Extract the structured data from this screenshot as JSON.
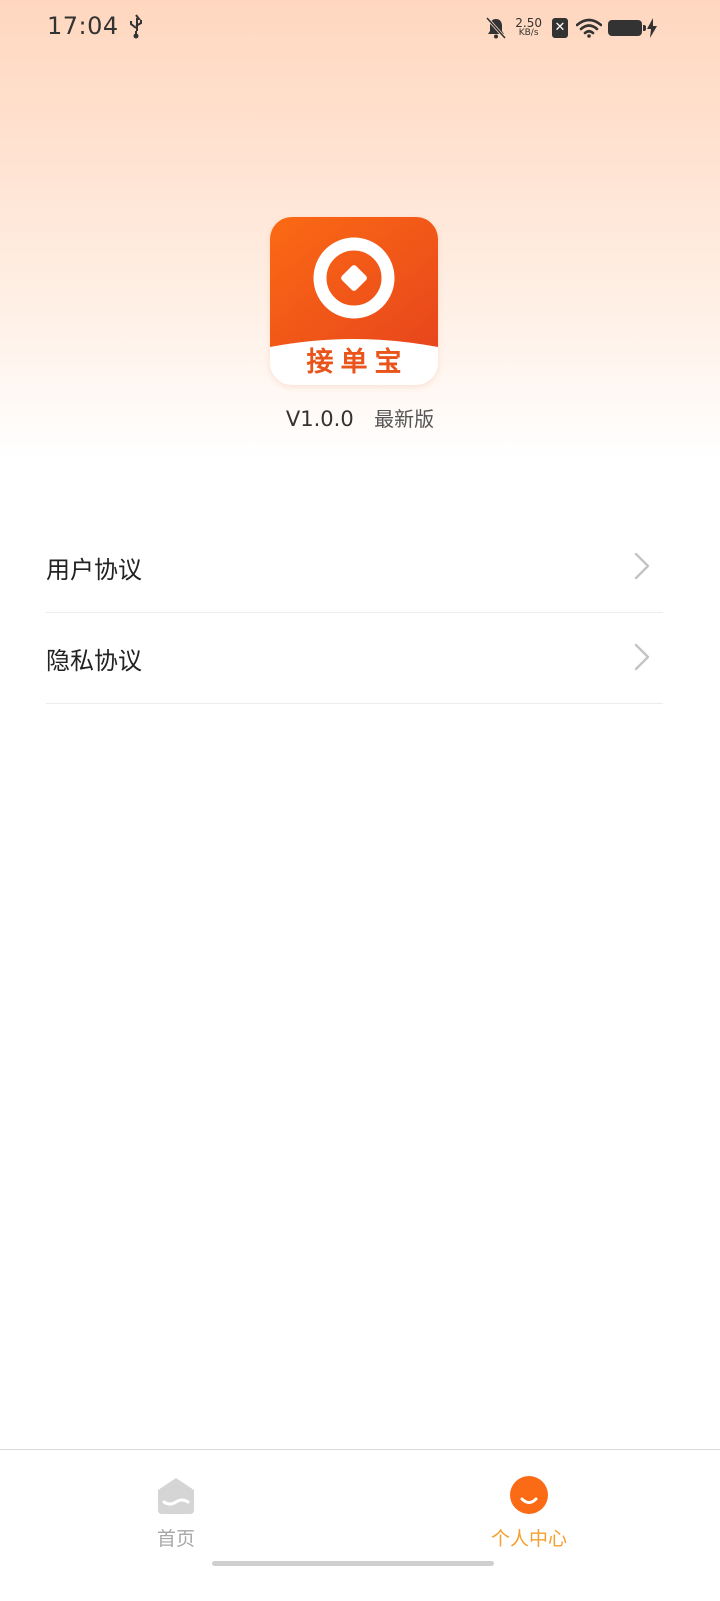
{
  "status_bar": {
    "time": "17:04",
    "net_speed_value": "2.50",
    "net_speed_unit": "KB/s",
    "icons": [
      "usb-icon",
      "bell-muted-icon",
      "sim-x-icon",
      "wifi-icon",
      "battery-icon",
      "charging-icon"
    ]
  },
  "app": {
    "logo_text": "接单宝",
    "version": "V1.0.0",
    "version_tag": "最新版",
    "colors": {
      "brand_orange": "#fb6a14",
      "brand_red": "#e8461c",
      "accent_tab": "#f4a02d"
    }
  },
  "menu": {
    "items": [
      {
        "label": "用户协议",
        "icon": "chevron-right-icon"
      },
      {
        "label": "隐私协议",
        "icon": "chevron-right-icon"
      }
    ]
  },
  "tab_bar": {
    "tabs": [
      {
        "label": "首页",
        "icon": "home-icon",
        "active": false
      },
      {
        "label": "个人中心",
        "icon": "profile-icon",
        "active": true
      }
    ]
  }
}
